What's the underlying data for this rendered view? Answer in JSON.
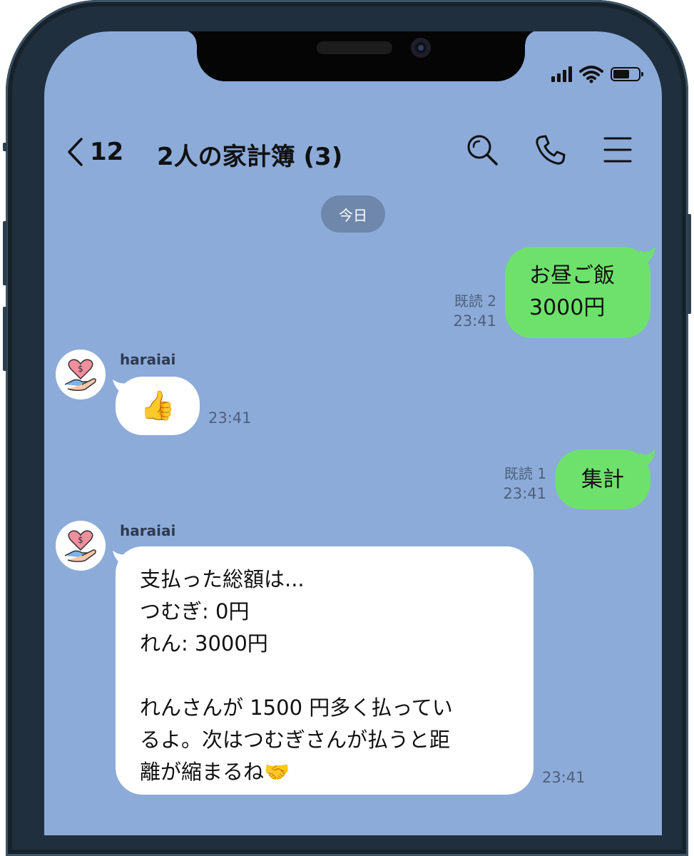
{
  "header": {
    "back_count": "12",
    "title": "2人の家計簿 (3)"
  },
  "date_divider": "今日",
  "messages": [
    {
      "type": "me",
      "lines": [
        "お昼ご飯",
        "3000円"
      ],
      "read": "既読 2",
      "time": "23:41"
    },
    {
      "type": "bot",
      "sender": "haraiai",
      "emoji": "👍",
      "time": "23:41"
    },
    {
      "type": "me",
      "lines": [
        "集計"
      ],
      "read": "既読 1",
      "time": "23:41"
    },
    {
      "type": "bot",
      "sender": "haraiai",
      "lines": [
        "支払った総額は...",
        "つむぎ: 0円",
        "れん: 3000円",
        "",
        "れんさんが 1500 円多く払ってい",
        "るよ。次はつむぎさんが払うと距",
        "離が縮まるね🤝"
      ],
      "time": "23:41"
    }
  ],
  "colors": {
    "chat_background": "#8cabd9",
    "my_bubble": "#6ee16d",
    "bot_bubble": "#ffffff"
  },
  "icons": [
    "back-chevron-icon",
    "search-icon",
    "phone-icon",
    "menu-icon",
    "signal-icon",
    "wifi-icon",
    "battery-icon",
    "haraiai-avatar-icon"
  ]
}
